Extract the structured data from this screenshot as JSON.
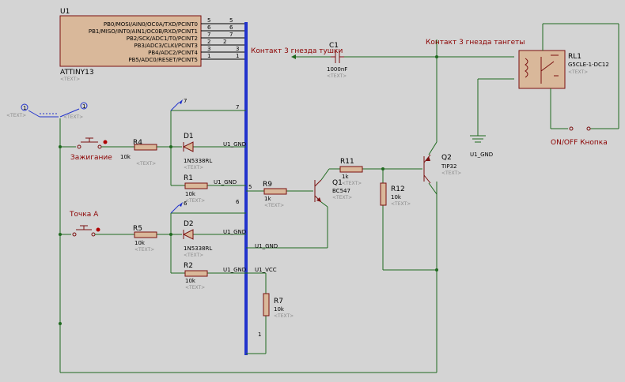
{
  "u1": {
    "ref": "U1",
    "part": "ATTINY13",
    "pins": [
      {
        "name": "PB0/MOSI/AIN0/OC0A/TXD/PCINT0",
        "num": "5",
        "bus": "5"
      },
      {
        "name": "PB1/MISO/INT0/AIN1/OC0B/RXD/PCINT1",
        "num": "6",
        "bus": "6"
      },
      {
        "name": "PB2/SCK/ADC1/T0/PCINT2",
        "num": "7",
        "bus": "7"
      },
      {
        "name": "PB3/ADC3/CLKI/PCINT3",
        "num": "2",
        "bus": "2"
      },
      {
        "name": "PB4/ADC2/PCINT4",
        "num": "3",
        "bus": "3"
      },
      {
        "name": "PB5/ADC0/RESET/PCINT5",
        "num": "1",
        "bus": "1"
      }
    ]
  },
  "text_placeholder": "<TEXT>",
  "components": {
    "c1": {
      "ref": "C1",
      "value": "1000nF"
    },
    "rl1": {
      "ref": "RL1",
      "value": "G5CLE-1-DC12"
    },
    "r4": {
      "ref": "R4",
      "value": "10k"
    },
    "d1": {
      "ref": "D1",
      "value": "1N5338RL"
    },
    "r1": {
      "ref": "R1",
      "value": "10k"
    },
    "r9": {
      "ref": "R9",
      "value": "1k"
    },
    "r11": {
      "ref": "R11",
      "value": "1k"
    },
    "q1": {
      "ref": "Q1",
      "value": "BC547"
    },
    "r12": {
      "ref": "R12",
      "value": "10k"
    },
    "q2": {
      "ref": "Q2",
      "value": "TIP32"
    },
    "r5": {
      "ref": "R5",
      "value": "10k"
    },
    "d2": {
      "ref": "D2",
      "value": "1N5338RL"
    },
    "r2": {
      "ref": "R2",
      "value": "10k"
    },
    "r7": {
      "ref": "R7",
      "value": "10k"
    }
  },
  "net_labels": {
    "contact3_tushka": "Контакт 3 гнезда тушки",
    "contact3_tangety": "Контакт 3 гнезда тангеты",
    "onoff_button": "ON/OFF Кнопка",
    "ignition": "Зажигание",
    "point_a": "Точка A",
    "u1_gnd": "U1_GND",
    "u1_vcc": "U1_VCC"
  },
  "bus_numbers": {
    "n7": "7",
    "n5": "5",
    "n6": "6",
    "n1": "1",
    "probe1": "1",
    "probe7": "7",
    "probe6": "6"
  },
  "colors": {
    "background": "#d4d4d4",
    "wire": "#1f6a1f",
    "component": "#7a1010",
    "bus": "#2233cc",
    "label_red": "#8b0000"
  }
}
